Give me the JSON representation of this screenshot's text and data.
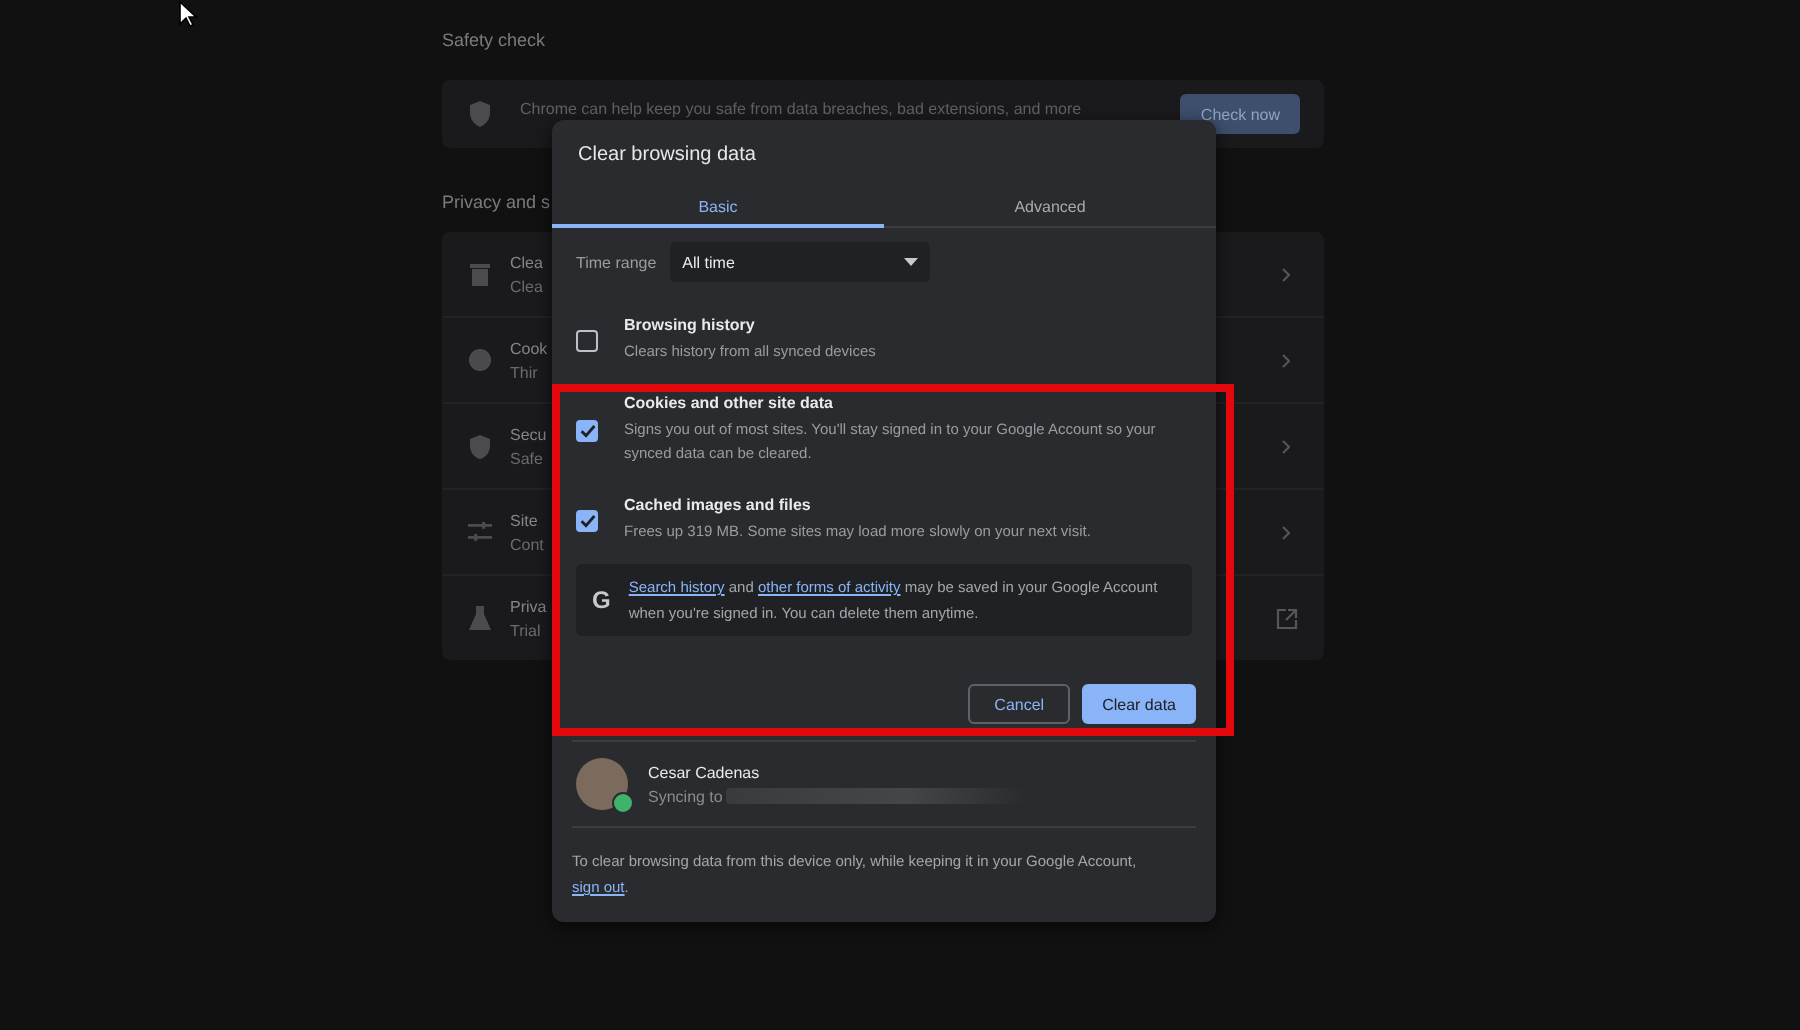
{
  "settings_page": {
    "safety_check": {
      "heading": "Safety check",
      "text": "Chrome can help keep you safe from data breaches, bad extensions, and more",
      "button": "Check now"
    },
    "privacy": {
      "heading": "Privacy and s",
      "rows": [
        {
          "kind": "subpage",
          "title": "Clea",
          "subtitle": "Clea"
        },
        {
          "kind": "subpage",
          "title": "Cook",
          "subtitle": "Thir"
        },
        {
          "kind": "subpage",
          "title": "Secu",
          "subtitle": "Safe"
        },
        {
          "kind": "subpage",
          "title": "Site",
          "subtitle": "Cont"
        },
        {
          "kind": "external",
          "title": "Priva",
          "subtitle": "Trial"
        }
      ]
    }
  },
  "dialog": {
    "title": "Clear browsing data",
    "tabs": [
      {
        "label": "Basic",
        "selected": true
      },
      {
        "label": "Advanced",
        "selected": false
      }
    ],
    "time_range": {
      "label": "Time range",
      "value": "All time"
    },
    "options": [
      {
        "title": "Browsing history",
        "description": "Clears history from all synced devices",
        "checked": false
      },
      {
        "title": "Cookies and other site data",
        "description": "Signs you out of most sites. You'll stay signed in to your Google Account so your synced data can be cleared.",
        "checked": true
      },
      {
        "title": "Cached images and files",
        "description": "Frees up 319 MB. Some sites may load more slowly on your next visit.",
        "checked": true
      }
    ],
    "notice": {
      "icon": "G",
      "parts": [
        {
          "text": "Search history",
          "link": true
        },
        {
          "text": " and ",
          "link": false
        },
        {
          "text": "other forms of activity",
          "link": true
        },
        {
          "text": " may be saved in your Google Account when you're signed in. You can delete them anytime.",
          "link": false
        }
      ]
    },
    "buttons": {
      "cancel": "Cancel",
      "confirm": "Clear data"
    },
    "account": {
      "name": "Cesar Cadenas",
      "status": "Syncing to"
    },
    "footer": {
      "text": "To clear browsing data from this device only, while keeping it in your Google Account,",
      "link": "sign out",
      "end": "."
    }
  }
}
